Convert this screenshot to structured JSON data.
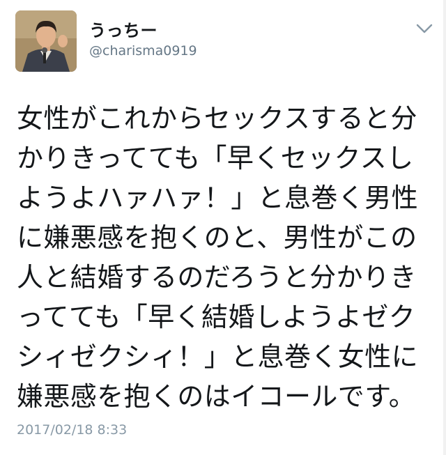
{
  "tweet": {
    "author": {
      "display_name": "うっちー",
      "handle": "@charisma0919",
      "avatar_icon": "user-avatar-photo"
    },
    "text": "女性がこれからセックスすると分\nかりきってても「早くセックスし\nようよハァハァ！」と息巻く男性\nに嫌悪感を抱くのと、男性がこの\n人と結婚するのだろうと分かりき\nってても「早く結婚しようよゼク\nシィゼクシィ！」と息巻く女性に\n嫌悪感を抱くのはイコールです。",
    "timestamp": "2017/02/18 8:33",
    "menu_icon": "chevron-down-icon"
  },
  "colors": {
    "text": "#14171a",
    "secondary": "#657786",
    "timestamp": "#8899a6",
    "background": "#ffffff"
  }
}
